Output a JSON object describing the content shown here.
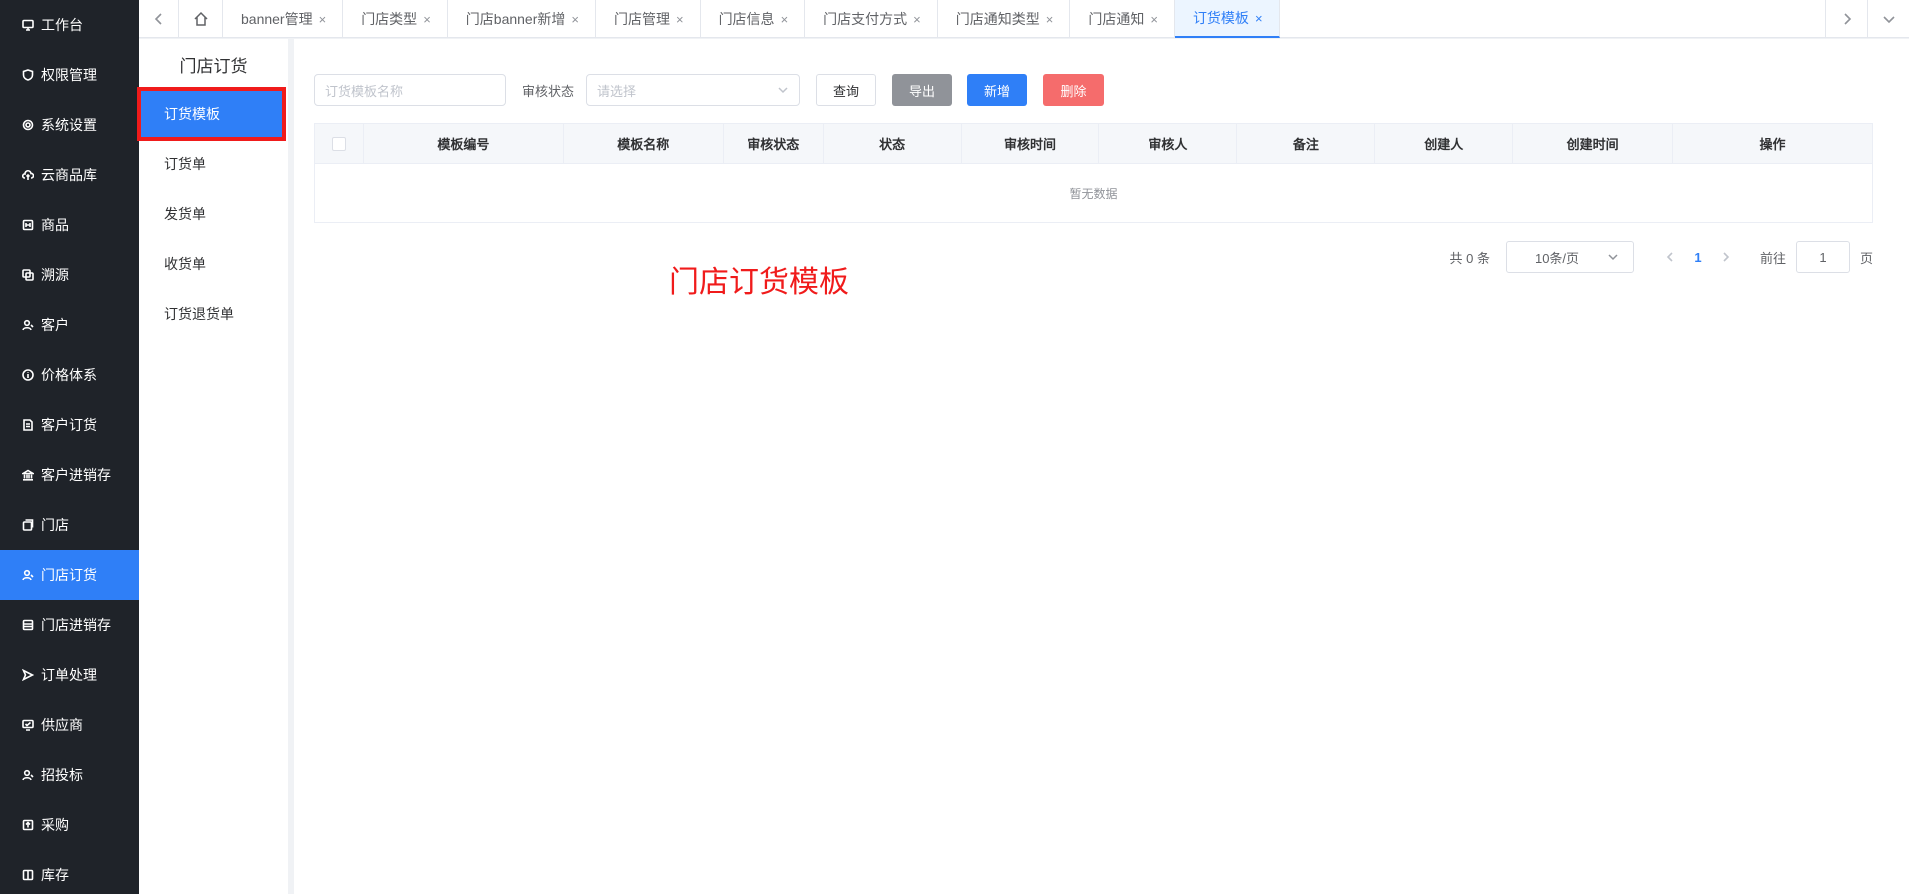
{
  "sidebar": {
    "items": [
      {
        "label": "工作台",
        "icon": "monitor-icon"
      },
      {
        "label": "权限管理",
        "icon": "shield-icon"
      },
      {
        "label": "系统设置",
        "icon": "gear-icon"
      },
      {
        "label": "云商品库",
        "icon": "cloud-upload-icon"
      },
      {
        "label": "商品",
        "icon": "goods-icon"
      },
      {
        "label": "溯源",
        "icon": "copy-icon"
      },
      {
        "label": "客户",
        "icon": "user-icon"
      },
      {
        "label": "价格体系",
        "icon": "info-icon"
      },
      {
        "label": "客户订货",
        "icon": "document-icon"
      },
      {
        "label": "客户进销存",
        "icon": "bank-icon"
      },
      {
        "label": "门店",
        "icon": "store-icon"
      },
      {
        "label": "门店订货",
        "icon": "user-icon",
        "active": true
      },
      {
        "label": "门店进销存",
        "icon": "box-icon"
      },
      {
        "label": "订单处理",
        "icon": "send-icon"
      },
      {
        "label": "供应商",
        "icon": "screen-icon"
      },
      {
        "label": "招投标",
        "icon": "user-icon"
      },
      {
        "label": "采购",
        "icon": "upload-icon"
      },
      {
        "label": "库存",
        "icon": "columns-icon"
      }
    ]
  },
  "tabs": [
    {
      "label": "banner管理"
    },
    {
      "label": "门店类型"
    },
    {
      "label": "门店banner新增"
    },
    {
      "label": "门店管理"
    },
    {
      "label": "门店信息"
    },
    {
      "label": "门店支付方式"
    },
    {
      "label": "门店通知类型"
    },
    {
      "label": "门店通知"
    },
    {
      "label": "订货模板",
      "active": true
    }
  ],
  "tab_close": "×",
  "submenu": {
    "title": "门店订货",
    "items": [
      {
        "label": "订货模板",
        "active": true
      },
      {
        "label": "订货单"
      },
      {
        "label": "发货单"
      },
      {
        "label": "收货单"
      },
      {
        "label": "订货退货单"
      }
    ]
  },
  "filters": {
    "name_placeholder": "订货模板名称",
    "status_label": "审核状态",
    "status_placeholder": "请选择",
    "query": "查询",
    "export": "导出",
    "add": "新增",
    "delete": "删除"
  },
  "table": {
    "columns": [
      "模板编号",
      "模板名称",
      "审核状态",
      "状态",
      "审核时间",
      "审核人",
      "备注",
      "创建人",
      "创建时间",
      "操作"
    ],
    "empty": "暂无数据"
  },
  "pagination": {
    "total": "共 0 条",
    "page_size": "10条/页",
    "current_page": "1",
    "goto_label": "前往",
    "goto_value": "1",
    "unit": "页"
  },
  "annotation": "门店订货模板",
  "colors": {
    "sidebar_bg": "#1f2329",
    "accent": "#2f7ff7",
    "danger": "#f56c6c",
    "highlight_red": "#f01b1b"
  }
}
